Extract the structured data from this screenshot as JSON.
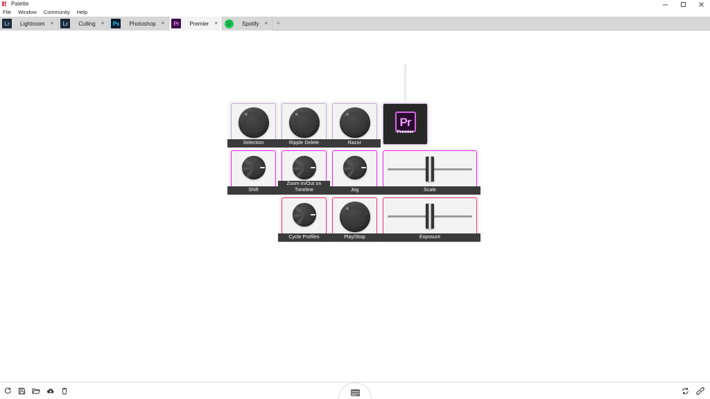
{
  "window": {
    "title": "Palette",
    "logo_icon": "palette-logo-icon",
    "controls": {
      "minimize": "minimize-icon",
      "maximize": "maximize-icon",
      "close": "close-icon"
    }
  },
  "menubar": {
    "items": [
      "File",
      "Window",
      "Community",
      "Help"
    ]
  },
  "tabs": {
    "add_label": "+",
    "close_label": "×",
    "items": [
      {
        "label": "Lightroom",
        "icon_text": "Lr",
        "icon_bg": "#1c2a3a",
        "icon_fg": "#8fb8d8",
        "active": false
      },
      {
        "label": "Culling",
        "icon_text": "Lr",
        "icon_bg": "#1c2a3a",
        "icon_fg": "#8fb8d8",
        "active": false
      },
      {
        "label": "Photoshop",
        "icon_text": "Ps",
        "icon_bg": "#0b1b2b",
        "icon_fg": "#31c5f4",
        "active": false
      },
      {
        "label": "Premier",
        "icon_text": "Pr",
        "icon_bg": "#3c0d4a",
        "icon_fg": "#e07ef0",
        "active": true
      },
      {
        "label": "Spotify",
        "icon_text": "",
        "icon_bg": "#1cc955",
        "icon_fg": "#0d7a32",
        "active": false
      }
    ]
  },
  "device": {
    "cable_icon": "cable-icon",
    "rows": [
      {
        "modules": [
          {
            "name": "selection",
            "label": "Selection",
            "type": "knob-big",
            "accent": "hi-violet"
          },
          {
            "name": "ripple-delete",
            "label": "Ripple Delete",
            "type": "knob-big",
            "accent": "hi-violet"
          },
          {
            "name": "razor",
            "label": "Razor",
            "type": "knob-big",
            "accent": "hi-violet"
          },
          {
            "name": "premier-hub",
            "label": "Premier",
            "type": "hub",
            "accent": "hi-violet",
            "badge": "Pr"
          }
        ]
      },
      {
        "modules": [
          {
            "name": "shift",
            "label": "Shift",
            "type": "knob-small",
            "accent": "hi-magenta"
          },
          {
            "name": "zoom-in-out",
            "label": "Zoom In/Out on Timeline",
            "type": "knob-small",
            "accent": "hi-magenta"
          },
          {
            "name": "jog",
            "label": "Jog",
            "type": "knob-small",
            "accent": "hi-magenta"
          },
          {
            "name": "scale",
            "label": "Scale",
            "type": "slider",
            "accent": "hi-magenta"
          }
        ]
      },
      {
        "modules": [
          {
            "name": "cycle-profiles",
            "label": "Cycle Profiles",
            "type": "knob-small",
            "accent": "hi-pink"
          },
          {
            "name": "play-stop",
            "label": "Play/Stop",
            "type": "knob-big",
            "accent": "hi-pink"
          },
          {
            "name": "exposure",
            "label": "Exposure",
            "type": "slider",
            "accent": "hi-pink"
          }
        ]
      }
    ]
  },
  "bottombar": {
    "left_icons": [
      {
        "name": "refresh-icon",
        "title": "Refresh"
      },
      {
        "name": "save-icon",
        "title": "Save"
      },
      {
        "name": "open-folder-icon",
        "title": "Open"
      },
      {
        "name": "cloud-upload-icon",
        "title": "Upload"
      },
      {
        "name": "trash-icon",
        "title": "Delete"
      }
    ],
    "right_icons": [
      {
        "name": "sync-icon",
        "title": "Sync"
      },
      {
        "name": "disconnected-plug-icon",
        "title": "Disconnected"
      }
    ],
    "drawer_handle_icon": "panel-window-icon"
  },
  "colors": {
    "accent_violet": "#b79fc9",
    "accent_magenta": "#f61ef4",
    "accent_pink": "#fb2a7a",
    "tabstrip_bg": "#d7d7d7",
    "active_tab_bg": "#f3f3f3",
    "module_bg": "#f1f1f1",
    "label_bg": "#3b3b3b"
  }
}
